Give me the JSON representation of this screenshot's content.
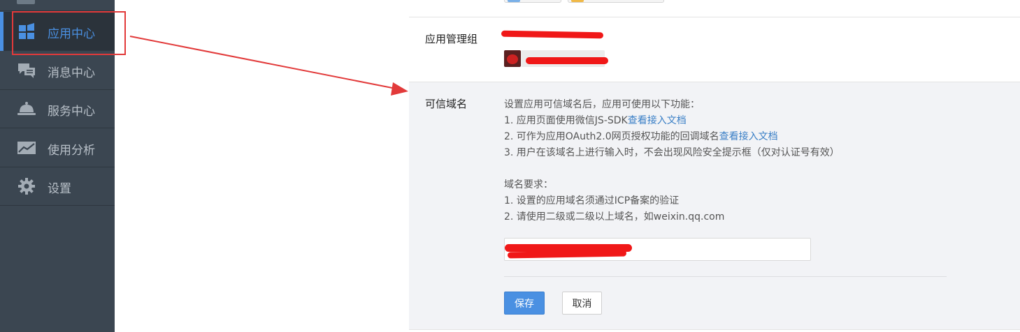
{
  "sidebar": {
    "items": [
      {
        "label": "应用中心",
        "icon": "apps-grid-icon",
        "active": true
      },
      {
        "label": "消息中心",
        "icon": "chat-bubbles-icon"
      },
      {
        "label": "服务中心",
        "icon": "service-bell-icon"
      },
      {
        "label": "使用分析",
        "icon": "trend-chart-icon"
      },
      {
        "label": "设置",
        "icon": "gear-icon"
      }
    ]
  },
  "admin_group": {
    "label": "应用管理组"
  },
  "trusted_domain": {
    "label": "可信域名",
    "intro": "设置应用可信域名后，应用可使用以下功能：",
    "feature1_text": "1. 应用页面使用微信JS-SDK",
    "feature1_link": "查看接入文档",
    "feature2_text": "2. 可作为应用OAuth2.0网页授权功能的回调域名",
    "feature2_link": "查看接入文档",
    "feature3_text": "3. 用户在该域名上进行输入时，不会出现风险安全提示框（仅对认证号有效）",
    "req_title": "域名要求：",
    "req1": "1. 设置的应用域名须通过ICP备案的验证",
    "req2": "2. 请使用二级或二级以上域名，如weixin.qq.com",
    "input_value": "",
    "save_label": "保存",
    "cancel_label": "取消"
  },
  "colors": {
    "sidebar_bg": "#3b4651",
    "accent": "#4a90e2",
    "link": "#3a7fc6",
    "panel_bg": "#f2f3f6",
    "annotation": "#e23a3a"
  }
}
